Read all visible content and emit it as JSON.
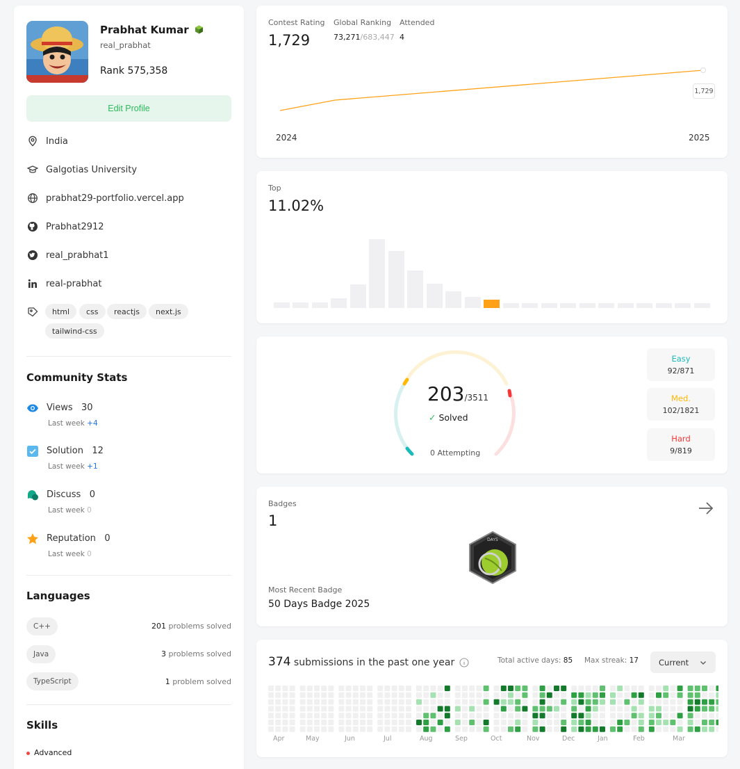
{
  "profile": {
    "name": "Prabhat Kumar",
    "username": "real_prabhat",
    "rank_label": "Rank",
    "rank_value": "575,358",
    "edit_label": "Edit Profile",
    "location": "India",
    "university": "Galgotias University",
    "website": "prabhat29-portfolio.vercel.app",
    "github": "Prabhat2912",
    "twitter": "real_prabhat1",
    "linkedin": "real-prabhat",
    "tags": [
      "html",
      "css",
      "reactjs",
      "next.js",
      "tailwind-css"
    ]
  },
  "community": {
    "title": "Community Stats",
    "stats": [
      {
        "label": "Views",
        "value": "30",
        "sub": "Last week",
        "delta": "+4"
      },
      {
        "label": "Solution",
        "value": "12",
        "sub": "Last week",
        "delta": "+1"
      },
      {
        "label": "Discuss",
        "value": "0",
        "sub": "Last week",
        "delta": "0"
      },
      {
        "label": "Reputation",
        "value": "0",
        "sub": "Last week",
        "delta": "0"
      }
    ]
  },
  "languages": {
    "title": "Languages",
    "items": [
      {
        "name": "C++",
        "count": "201",
        "suffix": "problems solved"
      },
      {
        "name": "Java",
        "count": "3",
        "suffix": "problems solved"
      },
      {
        "name": "TypeScript",
        "count": "1",
        "suffix": "problem solved"
      }
    ]
  },
  "skills": {
    "title": "Skills",
    "level": "Advanced"
  },
  "contest": {
    "rating_label": "Contest Rating",
    "rating_value": "1,729",
    "global_label": "Global Ranking",
    "global_rank": "73,271",
    "global_total": "/683,447",
    "attended_label": "Attended",
    "attended_value": "4",
    "tooltip": "1,729",
    "year_start": "2024",
    "year_end": "2025"
  },
  "top": {
    "label": "Top",
    "value": "11.02%"
  },
  "solved": {
    "value": "203",
    "total": "/3511",
    "status": "Solved",
    "attempting": "0 Attempting",
    "easy_label": "Easy",
    "easy_value": "92/871",
    "med_label": "Med.",
    "med_value": "102/1821",
    "hard_label": "Hard",
    "hard_value": "9/819"
  },
  "badges": {
    "label": "Badges",
    "count": "1",
    "badge_text": "DAYS",
    "recent_label": "Most Recent Badge",
    "recent_name": "50 Days Badge 2025"
  },
  "submissions": {
    "count": "374",
    "title_suffix": "submissions in the past one year",
    "active_label": "Total active days:",
    "active_value": "85",
    "streak_label": "Max streak:",
    "streak_value": "17",
    "select_value": "Current",
    "months": [
      "Apr",
      "May",
      "Jun",
      "Jul",
      "Aug",
      "Sep",
      "Oct",
      "Nov",
      "Dec",
      "Jan",
      "Feb",
      "Mar"
    ]
  },
  "colors": {
    "easy": "#1cbaba",
    "medium": "#ffb800",
    "hard": "#f63737",
    "accent_green": "#2cbb5d",
    "orange_bar": "#ffa116"
  }
}
